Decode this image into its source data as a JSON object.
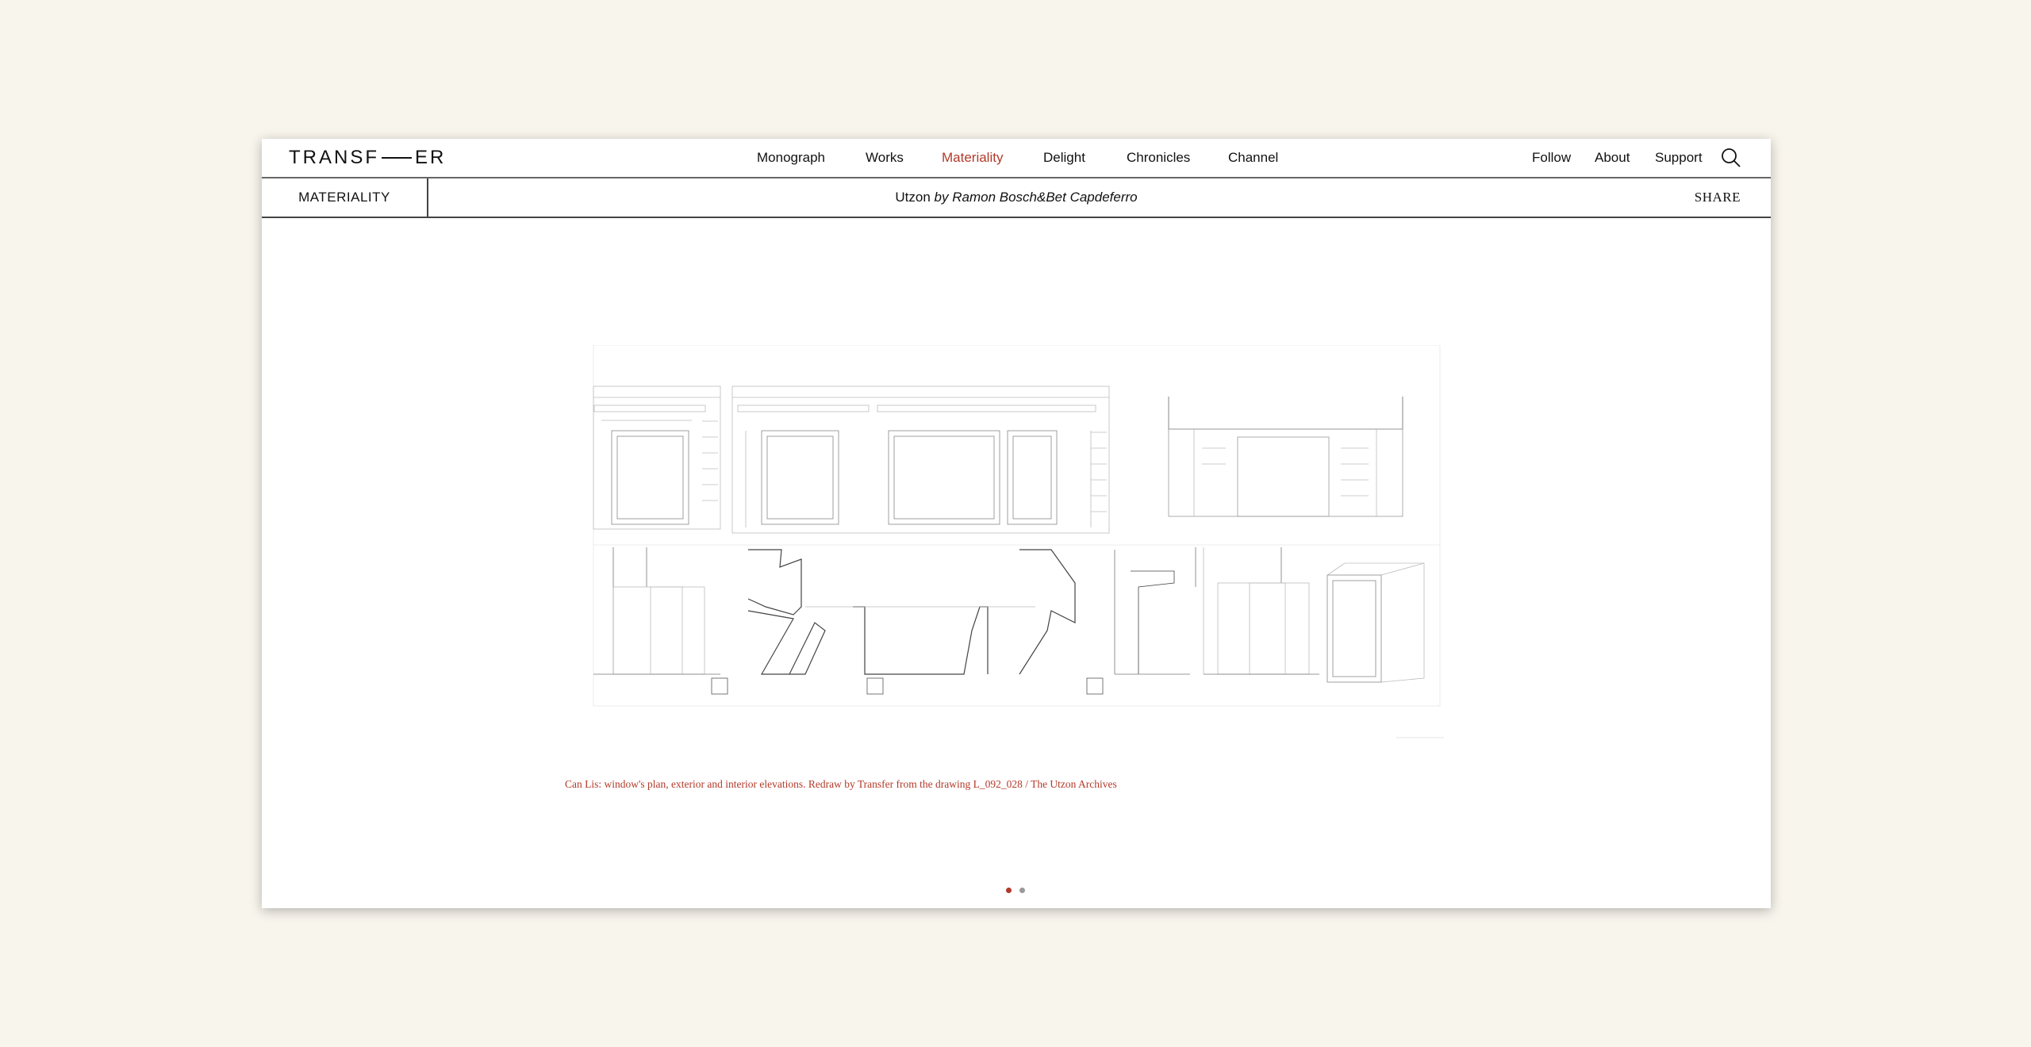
{
  "brand": {
    "left": "TRANSF",
    "right": "ER"
  },
  "nav": {
    "items": [
      {
        "label": "Monograph",
        "active": false
      },
      {
        "label": "Works",
        "active": false
      },
      {
        "label": "Materiality",
        "active": true
      },
      {
        "label": "Delight",
        "active": false
      },
      {
        "label": "Chronicles",
        "active": false
      },
      {
        "label": "Channel",
        "active": false
      }
    ],
    "right_items": [
      "Follow",
      "About",
      "Support"
    ],
    "search_icon": "search-icon"
  },
  "subheader": {
    "section": "MATERIALITY",
    "title_main": "Utzon",
    "title_by": "by",
    "title_authors": "Ramon Bosch&Bet Capdeferro",
    "share": "SHARE"
  },
  "slide": {
    "caption": "Can Lis: window's plan, exterior and interior elevations. Redraw by Transfer from the drawing L_092_028 / The Utzon Archives",
    "count": 2,
    "active_index": 0
  },
  "colors": {
    "accent": "#b23a2a",
    "background": "#f8f5ed",
    "dot_inactive": "#999999"
  }
}
